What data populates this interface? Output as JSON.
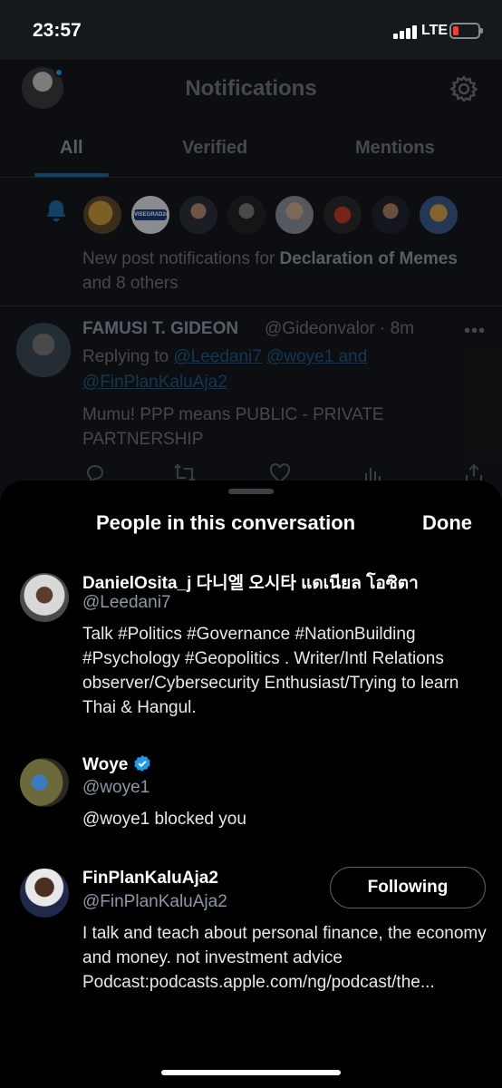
{
  "status_bar": {
    "time": "23:57",
    "network": "LTE"
  },
  "header": {
    "title": "Notifications"
  },
  "tabs": [
    {
      "label": "All"
    },
    {
      "label": "Verified"
    },
    {
      "label": "Mentions"
    }
  ],
  "notification": {
    "text_prefix": "New post notifications for ",
    "account_name": "Declaration of Memes",
    "text_suffix": " and 8 others",
    "mini_avatar_label": "VISEGRAD24"
  },
  "tweet": {
    "author_name": "FAMUSI T. GIDEON",
    "author_handle": "@Gideonvalor · 8m",
    "replying_to_label": "Replying to ",
    "mention_1": "@Leedani7",
    "mention_2": "@woye1",
    "and_label": " and ",
    "mention_3": "@FinPlanKaluAja2",
    "body": "Mumu! PPP means PUBLIC - PRIVATE PARTNERSHIP"
  },
  "sheet": {
    "title": "People in this conversation",
    "done_label": "Done",
    "people": [
      {
        "name": "DanielOsita_j 다니엘 오시타 แดเนียล โอซิตา",
        "handle": "@Leedani7",
        "bio": "Talk #Politics #Governance #NationBuilding #Psychology #Geopolitics . Writer/Intl Relations observer/Cybersecurity Enthusiast/Trying to learn Thai & Hangul."
      },
      {
        "name": "Woye",
        "handle": "@woye1",
        "bio": "@woye1 blocked you"
      },
      {
        "name": "FinPlanKaluAja2",
        "handle": "@FinPlanKaluAja2",
        "bio": "I talk and teach about personal finance, the economy and money. not investment advice Podcast:podcasts.apple.com/ng/podcast/the...",
        "button_label": "Following"
      }
    ]
  },
  "colors": {
    "accent": "#1d9bf0",
    "background": "#000000",
    "battery_low": "#ff3b30"
  }
}
